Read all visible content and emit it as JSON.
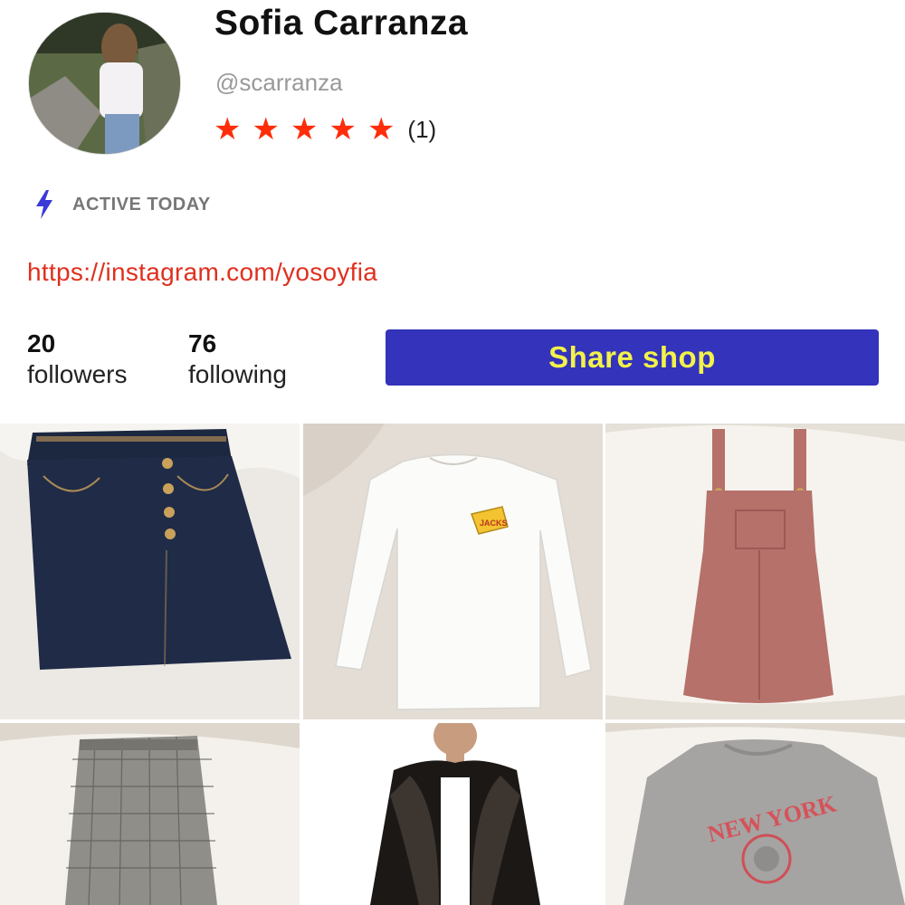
{
  "profile": {
    "name": "Sofia Carranza",
    "handle": "@scarranza",
    "rating_stars": 5,
    "review_count": "(1)",
    "activity": "ACTIVE TODAY",
    "link": "https://instagram.com/yosoyfia"
  },
  "stats": {
    "followers_count": "20",
    "followers_label": "followers",
    "following_count": "76",
    "following_label": "following"
  },
  "actions": {
    "share_label": "Share shop"
  },
  "listings": {
    "items": [
      {
        "type": "denim button-front skirt",
        "print": ""
      },
      {
        "type": "white long-sleeve tee",
        "print": "JACKS"
      },
      {
        "type": "pink corduroy overall dress",
        "print": ""
      },
      {
        "type": "plaid trousers",
        "print": ""
      },
      {
        "type": "black faux-leather jacket",
        "print": ""
      },
      {
        "type": "grey sweatshirt",
        "print": "NEW YORK"
      }
    ]
  },
  "colors": {
    "accent_red": "#ff2d0a",
    "link_red": "#e0301e",
    "button_bg": "#3333bb",
    "button_text": "#f2f24a",
    "muted_text": "#777777",
    "bolt_blue": "#3a3ad6"
  },
  "icons": {
    "activity": "lightning-bolt-icon",
    "rating": "star-icon"
  }
}
